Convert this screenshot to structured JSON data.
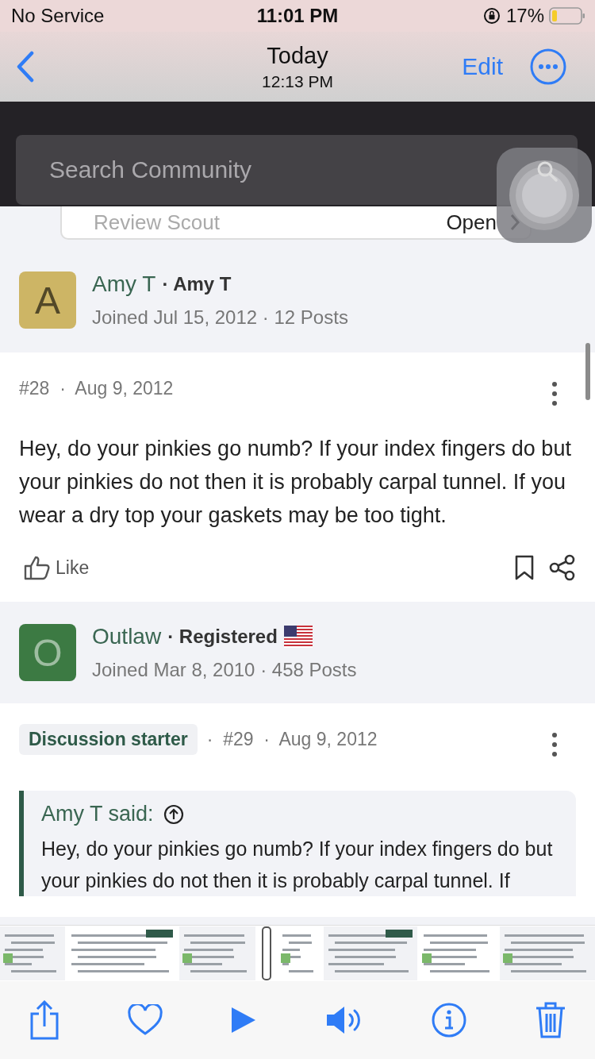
{
  "status_bar": {
    "carrier": "No Service",
    "time": "11:01 PM",
    "battery": "17%"
  },
  "nav": {
    "title": "Today",
    "subtitle": "12:13 PM",
    "edit": "Edit"
  },
  "screenshot": {
    "search": {
      "placeholder": "Search Community"
    },
    "banner": {
      "label": "Review Scout",
      "action": "Open"
    },
    "posts": [
      {
        "author": {
          "name": "Amy T",
          "title": "· Amy T",
          "initial": "A",
          "color": "#cdb565",
          "joined": "Joined Jul 15, 2012 · 12 Posts"
        },
        "meta": "#28  ·  Aug 9, 2012",
        "text": "Hey, do your pinkies go numb? If your index fingers do but your pinkies do not then it is probably carpal tunnel. If you wear a dry top your gaskets may be too tight.",
        "like": "Like"
      },
      {
        "author": {
          "name": "Outlaw",
          "title": "· Registered",
          "initial": "O",
          "color": "#3c7a43",
          "flag": true,
          "joined": "Joined Mar 8, 2010 · 458 Posts"
        },
        "badge": "Discussion starter",
        "meta": "·  #29  ·  Aug 9, 2012",
        "quote": {
          "author": "Amy T said:",
          "text": "Hey, do your pinkies go numb? If your index fingers do but your pinkies do not then it is probably carpal tunnel. If"
        }
      }
    ]
  }
}
